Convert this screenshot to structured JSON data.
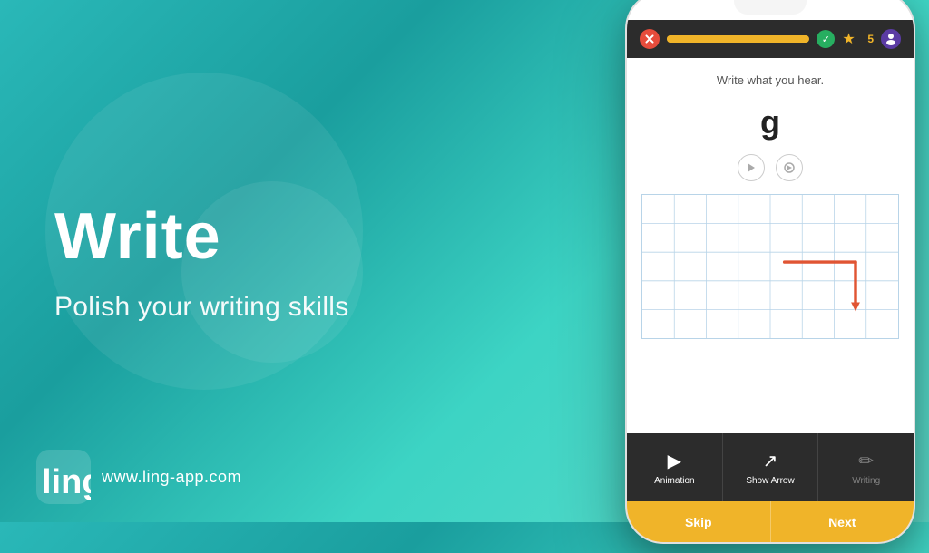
{
  "background": {
    "gradient_start": "#2ab8b8",
    "gradient_end": "#5dddcc"
  },
  "left": {
    "title": "Write",
    "subtitle": "Polish your writing skills"
  },
  "logo": {
    "url": "www.ling-app.com"
  },
  "phone": {
    "progress_bar": {
      "fill_percent": 85
    },
    "score": "5",
    "instruction": "Write what you hear.",
    "character": "g",
    "toolbar": {
      "animation_label": "Animation",
      "show_arrow_label": "Show Arrow",
      "writing_label": "Writing"
    },
    "skip_label": "Skip",
    "next_label": "Next"
  }
}
